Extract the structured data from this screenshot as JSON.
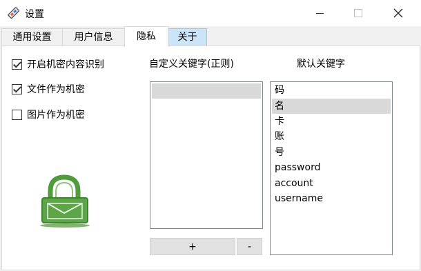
{
  "window": {
    "title": "设置"
  },
  "tabs": [
    {
      "label": "通用设置"
    },
    {
      "label": "用户信息"
    },
    {
      "label": "隐私",
      "active": true
    },
    {
      "label": "关于"
    }
  ],
  "privacy": {
    "checkboxes": [
      {
        "label": "开启机密内容识别",
        "checked": true
      },
      {
        "label": "文件作为机密",
        "checked": true
      },
      {
        "label": "图片作为机密",
        "checked": false
      }
    ],
    "custom_keywords": {
      "label": "自定义关键字(正则)",
      "items": [
        ""
      ]
    },
    "default_keywords": {
      "label": "默认关键字",
      "items": [
        "码",
        "名",
        "卡",
        "账",
        "号",
        "password",
        "account",
        "username"
      ],
      "selected_index": 1
    },
    "add_button": "+",
    "remove_button": "-"
  },
  "colors": {
    "lock_green": "#4f9b3e",
    "selection": "#d9d9d9",
    "about_tab_highlight": "#cce4f7"
  }
}
